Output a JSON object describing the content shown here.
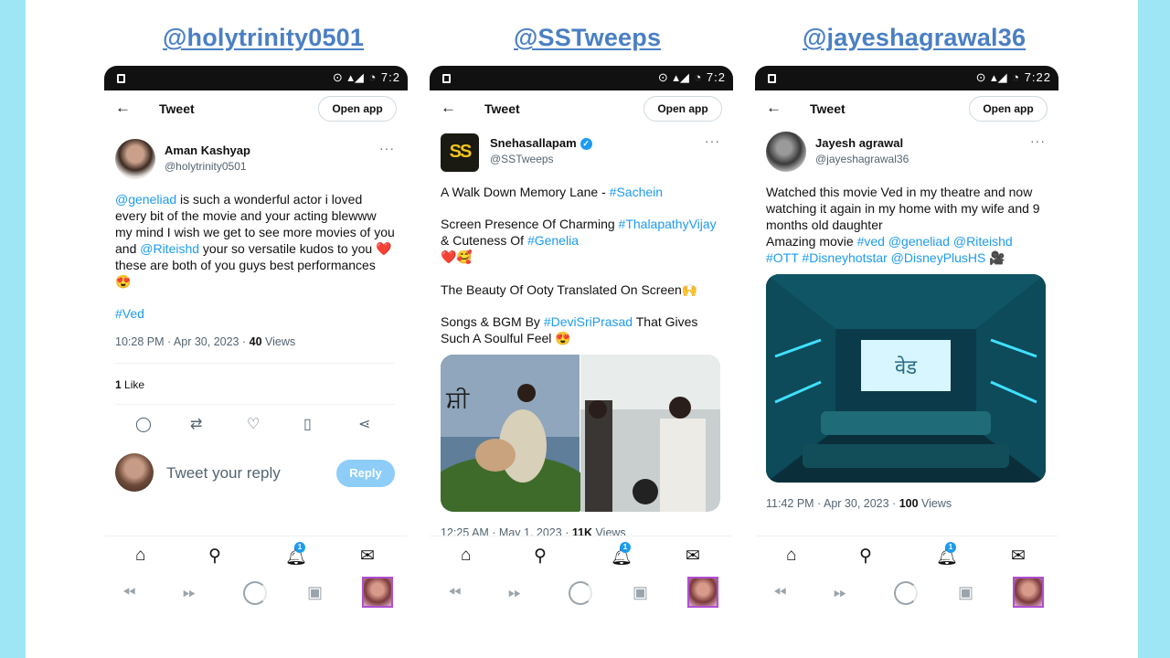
{
  "titles": [
    "@holytrinity0501",
    "@SSTweeps",
    "@jayeshagrawal36"
  ],
  "status": {
    "time": "7:2",
    "time3": "7:22"
  },
  "common": {
    "back_icon": "arrow-left-icon",
    "tweet_label": "Tweet",
    "open_app": "Open app",
    "more": "···",
    "reply_placeholder": "Tweet your reply",
    "reply_button": "Reply",
    "notification_count": "1"
  },
  "tweets": [
    {
      "name": "Aman Kashyap",
      "handle": "@holytrinity0501",
      "text": {
        "mention1": "@geneliad",
        "part1": " is such a wonderful actor i loved every bit of the movie and your acting blewww my mind I wish we get to see more movies of you and ",
        "mention2": "@Riteishd",
        "part2": " your so versatile kudos to you ❤️ these are both of you guys best performances 😍"
      },
      "hashtag": "#Ved",
      "time": "10:28 PM · Apr 30, 2023 · ",
      "views_count": "40",
      "views_label": " Views",
      "likes_count": "1",
      "likes_label": " Like"
    },
    {
      "name": "Snehasallapam",
      "handle": "@SSTweeps",
      "logo": "SS",
      "line1_text": "A Walk Down Memory Lane - ",
      "line1_tag": "#Sachein",
      "line2_text": "Screen Presence Of Charming ",
      "line2_tag1": "#ThalapathyVijay",
      "line2_mid": " & Cuteness Of ",
      "line2_tag2": "#Genelia",
      "line2_emoji": "❤️🥰",
      "line3": "The Beauty Of Ooty Translated On Screen🙌",
      "line4_text": "Songs & BGM By ",
      "line4_tag": "#DeviSriPrasad",
      "line4_end": " That Gives Such A Soulful Feel 😍",
      "time": "12:25 AM · May 1, 2023 · ",
      "views_count": "11K",
      "views_label": " Views"
    },
    {
      "name": "Jayesh agrawal",
      "handle": "@jayeshagrawal36",
      "text_plain": "Watched this movie Ved in my theatre and now watching it again in my home with my wife and 9 months old daughter",
      "amazing": "Amazing movie ",
      "tags": "#ved @geneliad @Riteishd #OTT #Disneyhotstar @DisneyPlusHS",
      "emoji": " 🎥",
      "screen_text": "वेड",
      "time": "11:42 PM · Apr 30, 2023 · ",
      "views_count": "100",
      "views_label": " Views"
    }
  ],
  "nav_icons": [
    "home-icon",
    "search-icon",
    "bell-icon",
    "mail-icon"
  ],
  "sys_icons": [
    "rewind-icon",
    "fast-forward-icon",
    "loading-circle-icon",
    "box-icon",
    "profile-thumbnail"
  ]
}
